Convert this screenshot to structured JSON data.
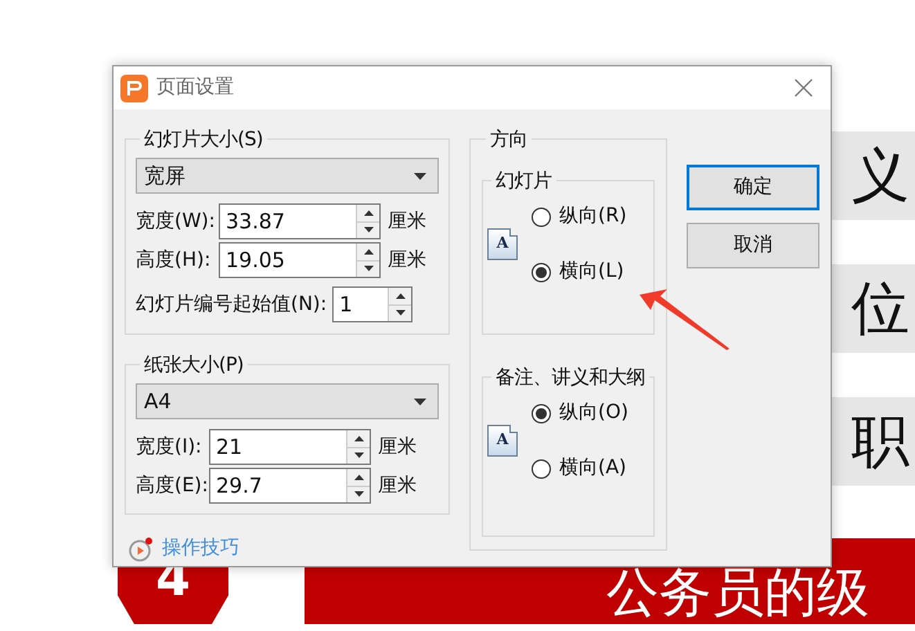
{
  "window": {
    "title": "页面设置"
  },
  "slide_size": {
    "legend": "幻灯片大小(S)",
    "preset": "宽屏",
    "fields": [
      {
        "label": "宽度(W):",
        "value": "33.87",
        "unit": "厘米"
      },
      {
        "label": "高度(H):",
        "value": "19.05",
        "unit": "厘米"
      }
    ],
    "start_number": {
      "label": "幻灯片编号起始值(N):",
      "value": "1"
    }
  },
  "paper_size": {
    "legend": "纸张大小(P)",
    "preset": "A4",
    "fields": [
      {
        "label": "宽度(I):",
        "value": "21",
        "unit": "厘米"
      },
      {
        "label": "高度(E):",
        "value": "29.7",
        "unit": "厘米"
      }
    ]
  },
  "tips_link": "操作技巧",
  "orientation": {
    "legend": "方向",
    "groups": [
      {
        "legend": "幻灯片",
        "icon_letter": "A",
        "options": [
          {
            "label": "纵向(R)",
            "selected": false
          },
          {
            "label": "横向(L)",
            "selected": true
          }
        ]
      },
      {
        "legend": "备注、讲义和大纲",
        "icon_letter": "A",
        "options": [
          {
            "label": "纵向(O)",
            "selected": true
          },
          {
            "label": "横向(A)",
            "selected": false
          }
        ]
      }
    ]
  },
  "buttons": [
    {
      "label": "确定",
      "default": true
    },
    {
      "label": "取消",
      "default": false
    }
  ],
  "background": {
    "slide_rows": [
      "义",
      "位",
      "职"
    ],
    "badge": "4",
    "banner": "公务员的级"
  }
}
